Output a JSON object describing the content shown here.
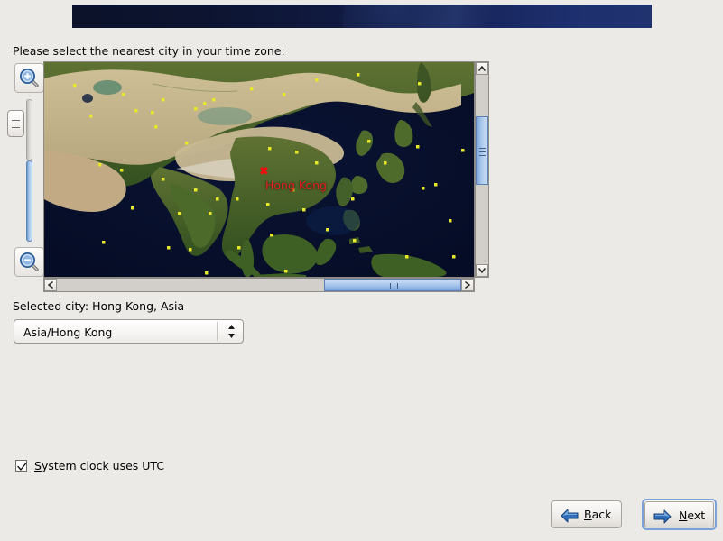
{
  "window": {
    "background_color": "#eceae7",
    "banner": {
      "name": "installer-banner",
      "gradient_from": "#0b1229",
      "gradient_to": "#20336f"
    }
  },
  "prompt": {
    "text": "Please select the nearest city in your time zone:"
  },
  "map": {
    "zoom_in_icon": "magnifier-plus-icon",
    "zoom_out_icon": "magnifier-minus-icon",
    "slider_name": "zoom-slider",
    "marker_glyph": "✖",
    "marker_color": "#f10d0d",
    "city_label": "Hong Kong",
    "city_label_color": "#e8221f",
    "ocean_color": "#050b28",
    "city_dot_color": "#e8e82a",
    "vscroll": {
      "up_icon": "chevron-up-icon",
      "down_icon": "chevron-down-icon"
    },
    "hscroll": {
      "left_icon": "chevron-left-icon",
      "right_icon": "chevron-right-icon"
    }
  },
  "selection": {
    "selected_city_text": "Selected city: Hong Kong, Asia",
    "timezone_value": "Asia/Hong Kong",
    "timezone_options": [
      "Asia/Hong Kong"
    ],
    "dropdown_icon": "updown-chevron-icon"
  },
  "options": {
    "utc_checkbox_checked": true,
    "utc_checkbox_mnemonic": "S",
    "utc_checkbox_label_rest": "ystem clock uses UTC",
    "check_icon": "checkmark-icon"
  },
  "navigation": {
    "back": {
      "mnemonic_prefix": "B",
      "mnemonic_char": "B",
      "label_rest": "ack",
      "icon": "arrow-left-icon",
      "icon_color": "#1f5fb0"
    },
    "next": {
      "prefix": "N",
      "mnemonic_char": "N",
      "label_rest": "ext",
      "icon": "arrow-right-icon",
      "icon_color": "#1f5fb0",
      "focused": true,
      "focus_color": "#7ba2d8"
    }
  }
}
